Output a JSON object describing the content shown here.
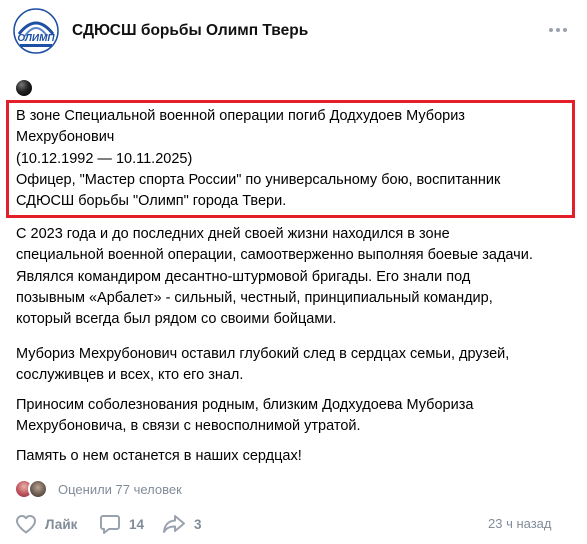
{
  "group": {
    "name": "СДЮСШ борьбы Олимп Тверь",
    "logo_text": "ОЛИМП"
  },
  "post": {
    "emoji": "black-circle",
    "highlighted_lines": [
      "В зоне Специальной военной операции погиб Додхудоев Мубориз",
      "Мехрубонович",
      "(10.12.1992 — 10.11.2025)",
      "Офицер, \"Мастер спорта России\" по универсальному бою, воспитанник",
      "СДЮСШ борьбы \"Олимп\" города Твери."
    ],
    "paragraph_2_lines": [
      "С 2023 года и до последних дней своей жизни находился в зоне",
      "специальной военной операции, самоотверженно выполняя боевые задачи.",
      "Являлся командиром десантно-штурмовой бригады. Его знали под",
      "позывным «Арбалет» - сильный, честный, принципиальный командир,",
      "который всегда был рядом со своими бойцами."
    ],
    "paragraph_3_lines": [
      "Мубориз Мехрубонович оставил глубокий след в сердцах семьи, друзей,",
      "сослуживцев и всех, кто его знал."
    ],
    "paragraph_4_lines": [
      "Приносим соболезнования родным, близким Додхудоева Мубориза",
      "Мехрубоновича, в связи с невосполнимой утратой."
    ],
    "paragraph_5_lines": [
      "Память о нем останется в наших сердцах!"
    ]
  },
  "viewers": {
    "text": "Оценили 77 человек"
  },
  "actions": {
    "like_label": "Лайк",
    "comments_count": "14",
    "shares_count": "3",
    "time": "23 ч назад"
  },
  "colors": {
    "highlight_border": "#e3202a",
    "muted_text": "#818c99",
    "logo_blue": "#1d4fa3"
  }
}
